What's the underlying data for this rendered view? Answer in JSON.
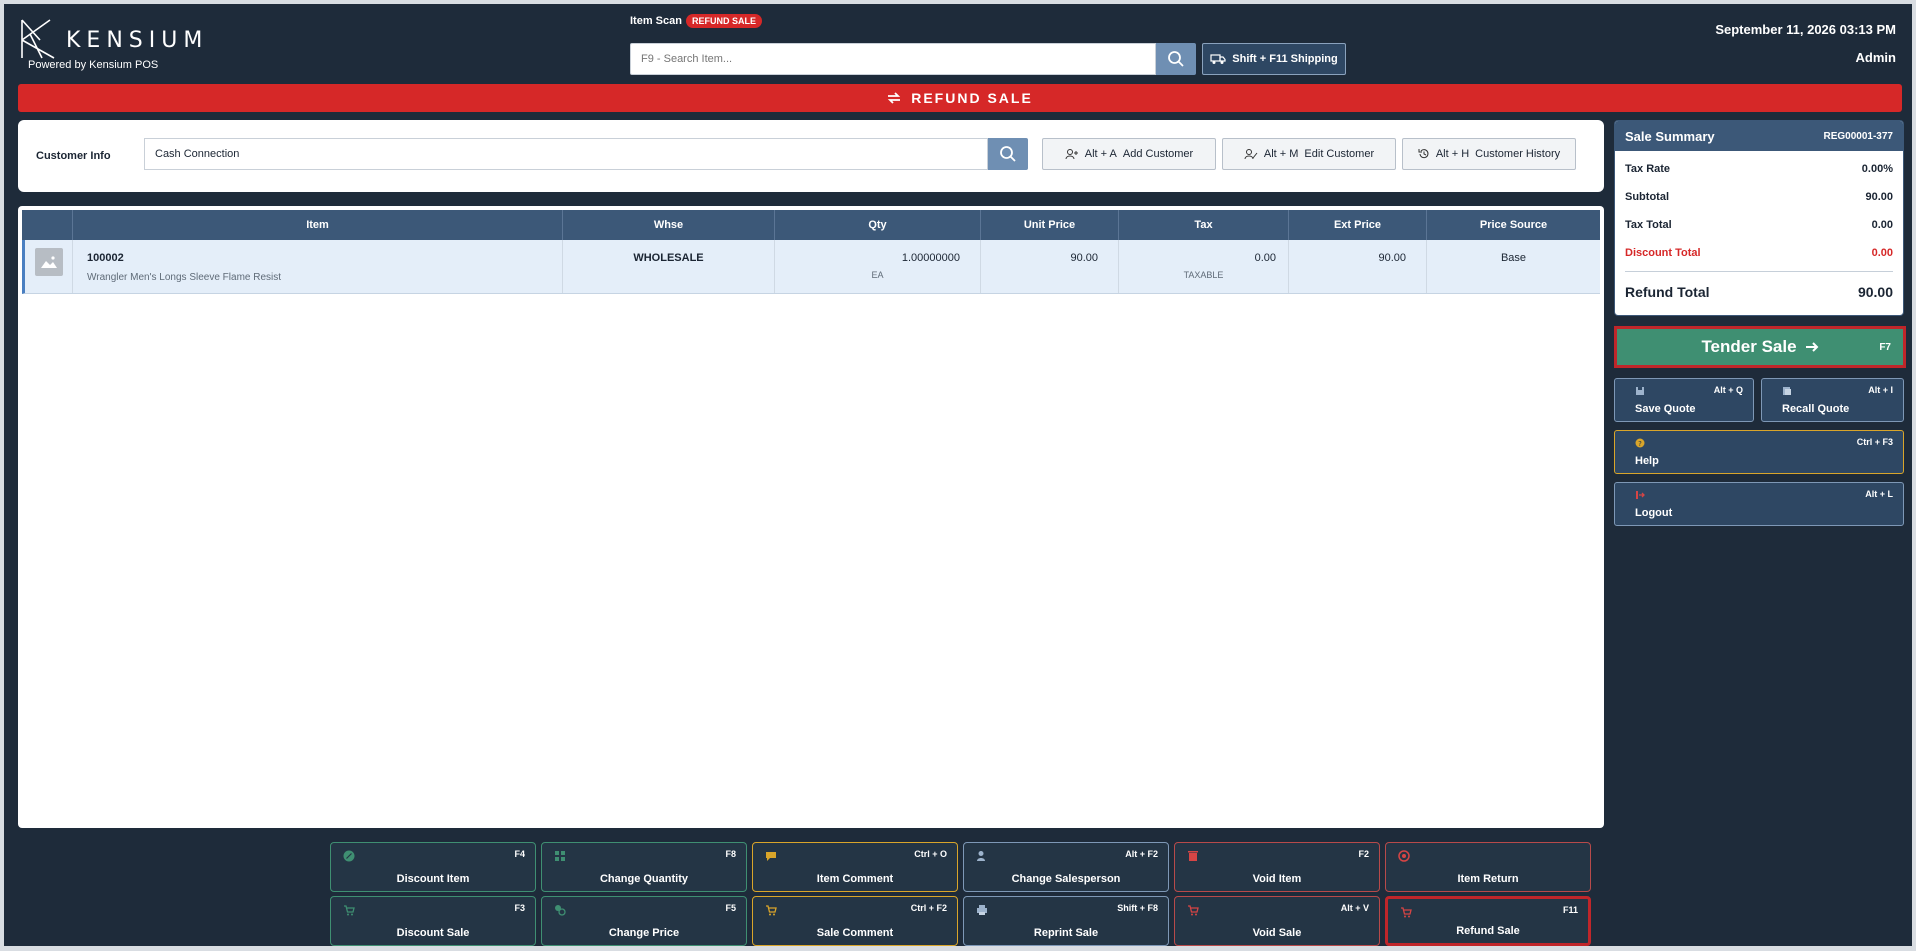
{
  "header": {
    "brand": "KENSIUM",
    "powered_by": "Powered by Kensium POS",
    "scan_label": "Item Scan",
    "mode_badge": "REFUND SALE",
    "search_placeholder": "F9 - Search Item...",
    "shipping_label": "Shift + F11 Shipping",
    "datetime": "September 11, 2026 03:13 PM",
    "user": "Admin"
  },
  "banner": {
    "text": "REFUND SALE"
  },
  "customer": {
    "label": "Customer Info",
    "value": "Cash Connection",
    "buttons": [
      {
        "key": "Alt + A",
        "label": "Add Customer"
      },
      {
        "key": "Alt + M",
        "label": "Edit Customer"
      },
      {
        "key": "Alt + H",
        "label": "Customer History"
      }
    ]
  },
  "table": {
    "columns": [
      "Item",
      "Whse",
      "Qty",
      "Unit Price",
      "Tax",
      "Ext Price",
      "Price Source"
    ],
    "rows": [
      {
        "item": "100002",
        "description": "Wrangler Men's Longs Sleeve Flame Resist",
        "whse": "WHOLESALE",
        "qty": "1.00000000",
        "uom": "EA",
        "unit_price": "90.00",
        "tax": "0.00",
        "tax_status": "TAXABLE",
        "ext_price": "90.00",
        "price_source": "Base"
      }
    ]
  },
  "summary": {
    "title": "Sale Summary",
    "register": "REG00001-377",
    "tax_rate_label": "Tax Rate",
    "tax_rate": "0.00%",
    "subtotal_label": "Subtotal",
    "subtotal": "90.00",
    "tax_total_label": "Tax Total",
    "tax_total": "0.00",
    "discount_label": "Discount Total",
    "discount": "0.00",
    "refund_label": "Refund Total",
    "refund": "90.00"
  },
  "tender": {
    "label": "Tender Sale",
    "key": "F7"
  },
  "side_buttons": {
    "save_quote": {
      "label": "Save Quote",
      "key": "Alt + Q"
    },
    "recall_quote": {
      "label": "Recall Quote",
      "key": "Alt + I"
    },
    "help": {
      "label": "Help",
      "key": "Ctrl + F3"
    },
    "logout": {
      "label": "Logout",
      "key": "Alt + L"
    }
  },
  "actions": {
    "discount_item": {
      "label": "Discount Item",
      "key": "F4"
    },
    "change_quantity": {
      "label": "Change Quantity",
      "key": "F8"
    },
    "item_comment": {
      "label": "Item Comment",
      "key": "Ctrl + O"
    },
    "change_salesperson": {
      "label": "Change Salesperson",
      "key": "Alt + F2"
    },
    "void_item": {
      "label": "Void Item",
      "key": "F2"
    },
    "item_return": {
      "label": "Item Return",
      "key": ""
    },
    "discount_sale": {
      "label": "Discount Sale",
      "key": "F3"
    },
    "change_price": {
      "label": "Change Price",
      "key": "F5"
    },
    "sale_comment": {
      "label": "Sale Comment",
      "key": "Ctrl + F2"
    },
    "reprint_sale": {
      "label": "Reprint Sale",
      "key": "Shift + F8"
    },
    "void_sale": {
      "label": "Void Sale",
      "key": "Alt + V"
    },
    "refund_sale": {
      "label": "Refund Sale",
      "key": "F11"
    }
  },
  "colors": {
    "background": "#1e2b3a",
    "header_blue": "#3c5878",
    "refund_red": "#d62828",
    "tender_green": "#3f8f72",
    "highlight": "#c0262a",
    "gold": "#d9a52a"
  }
}
